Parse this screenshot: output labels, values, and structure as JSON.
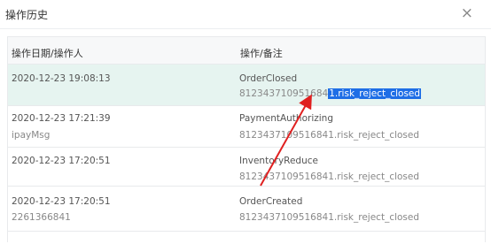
{
  "dialog": {
    "title": "操作历史",
    "close_glyph": "×"
  },
  "table": {
    "headers": [
      "操作日期/操作人",
      "操作/备注"
    ],
    "rows": [
      {
        "date": "2020-12-23 19:08:13",
        "operator": "",
        "operation": "OrderClosed",
        "note_prefix": "812343710951684",
        "note_highlight": "1.risk_reject_closed"
      },
      {
        "date": "2020-12-23 17:21:39",
        "operator": "ipayMsg",
        "operation": "PaymentAuthorizing",
        "note_prefix": "8123437109516841.risk_reject_closed",
        "note_highlight": ""
      },
      {
        "date": "2020-12-23 17:20:51",
        "operator": "",
        "operation": "InventoryReduce",
        "note_prefix": "8123437109516841.risk_reject_closed",
        "note_highlight": ""
      },
      {
        "date": "2020-12-23 17:20:51",
        "operator": "2261366841",
        "operation": "OrderCreated",
        "note_prefix": "8123437109516841.risk_reject_closed",
        "note_highlight": ""
      }
    ]
  },
  "colors": {
    "selected_row": "#e6f4f0",
    "highlight": "#1e6ee6",
    "arrow": "#e02020"
  }
}
